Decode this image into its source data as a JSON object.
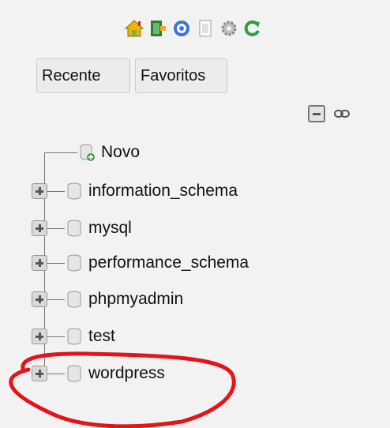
{
  "toolbar": {
    "icons": [
      "home-icon",
      "exit-icon",
      "help-icon",
      "documentation-icon",
      "settings-icon",
      "reload-icon"
    ]
  },
  "buttons": {
    "recent_label": "Recente",
    "favorites_label": "Favoritos"
  },
  "tree": {
    "new_label": "Novo",
    "databases": [
      {
        "label": "information_schema"
      },
      {
        "label": "mysql"
      },
      {
        "label": "performance_schema"
      },
      {
        "label": "phpmyadmin"
      },
      {
        "label": "test"
      },
      {
        "label": "wordpress"
      }
    ]
  },
  "annotation": {
    "color": "#e3151a"
  }
}
